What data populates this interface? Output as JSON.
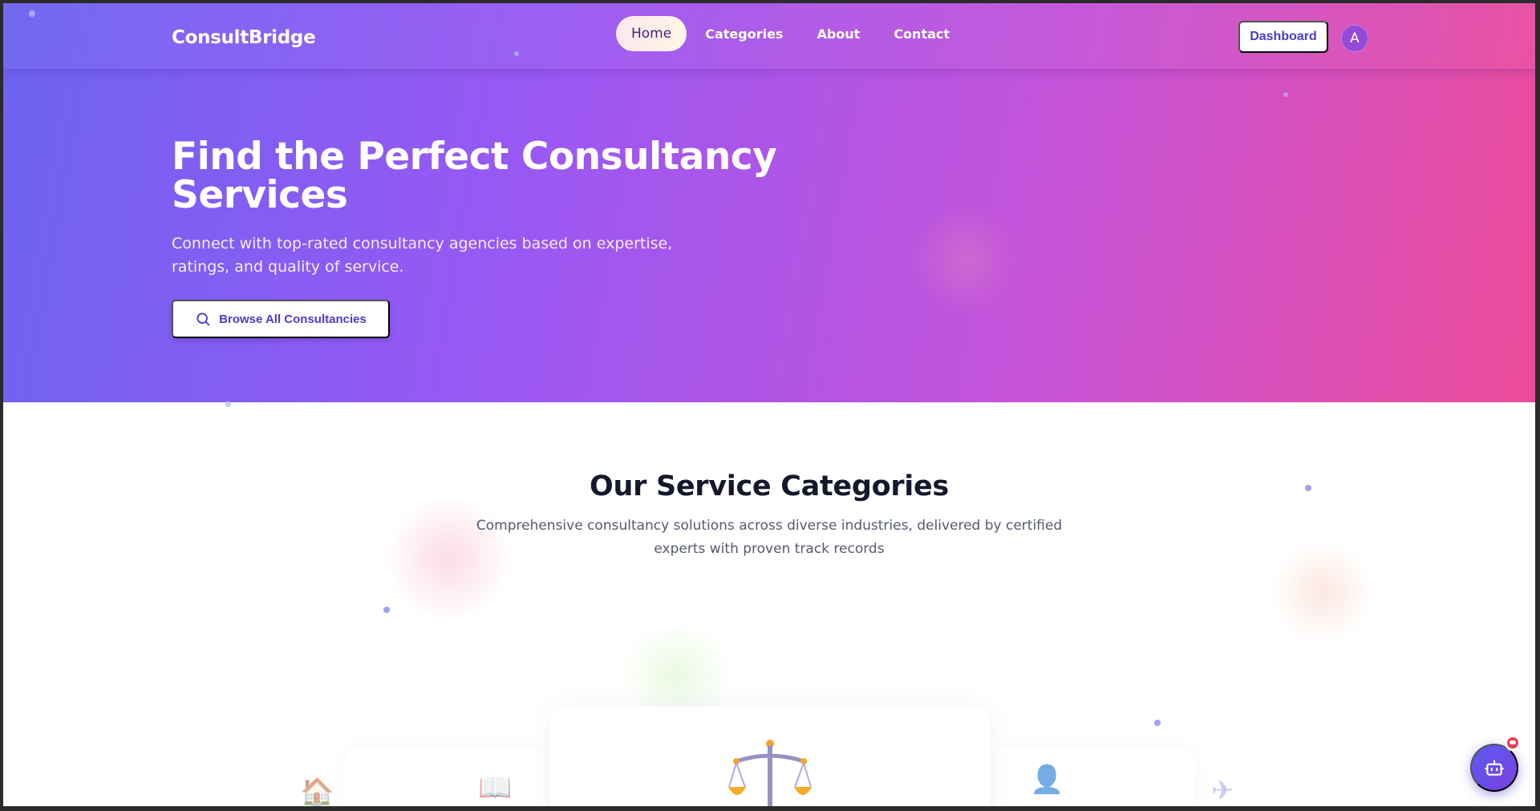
{
  "nav": {
    "brand": "ConsultBridge",
    "links": [
      {
        "label": "Home",
        "active": true
      },
      {
        "label": "Categories",
        "active": false
      },
      {
        "label": "About",
        "active": false
      },
      {
        "label": "Contact",
        "active": false
      }
    ],
    "dashboard_label": "Dashboard",
    "avatar_initial": "A"
  },
  "hero": {
    "title": "Find the Perfect Consultancy Services",
    "subtitle": "Connect with top-rated consultancy agencies based on expertise, ratings, and quality of service.",
    "browse_button": {
      "label": "Browse All Consultancies",
      "icon": "search-icon"
    }
  },
  "categories": {
    "title": "Our Service Categories",
    "subtitle": "Comprehensive consultancy solutions across diverse industries, delivered by certified experts with proven track records",
    "card_icons": [
      {
        "name": "house-icon",
        "glyph": "🏠"
      },
      {
        "name": "book-icon",
        "glyph": "📖"
      },
      {
        "name": "scales-icon",
        "glyph": "⚖"
      },
      {
        "name": "person-icon",
        "glyph": "👤"
      },
      {
        "name": "airplane-icon",
        "glyph": "✈"
      }
    ]
  },
  "chat_widget": {
    "icon": "robot-icon",
    "badge": "notification-badge"
  },
  "colors": {
    "gradient_start": "#6d63f1",
    "gradient_mid": "#a258f2",
    "gradient_end": "#ec4b99",
    "accent": "#4b3bcf",
    "heading": "#15172c"
  }
}
